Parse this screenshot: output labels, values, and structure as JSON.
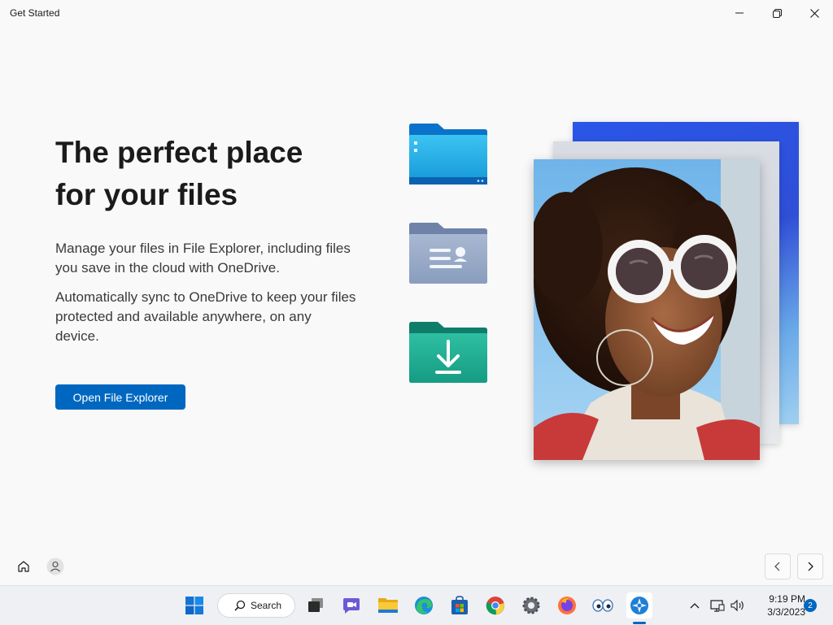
{
  "window": {
    "title": "Get Started",
    "minimize_icon": "minimize-icon",
    "maximize_icon": "restore-icon",
    "close_icon": "close-icon"
  },
  "content": {
    "headline_line1": "The perfect place",
    "headline_line2": "for your files",
    "paragraph1": "Manage your files in File Explorer, including files you save in the cloud with OneDrive.",
    "paragraph2": "Automatically sync to OneDrive to keep your files protected and available anywhere, on any device.",
    "primary_button": "Open File Explorer"
  },
  "illustration": {
    "folders": [
      "blue-folder-icon",
      "documents-folder-icon",
      "downloads-folder-icon"
    ]
  },
  "footer": {
    "home_icon": "home-icon",
    "account_icon": "person-icon",
    "back_icon": "chevron-left-icon",
    "next_icon": "chevron-right-icon"
  },
  "taskbar": {
    "search_label": "Search",
    "apps": [
      "start-icon",
      "search-icon",
      "task-view-icon",
      "chat-icon",
      "file-explorer-icon",
      "edge-icon",
      "store-icon",
      "chrome-icon",
      "settings-icon",
      "firefox-icon",
      "eyes-app-icon",
      "get-started-icon"
    ],
    "time": "9:19 PM",
    "date": "3/3/2023",
    "notification_count": "2"
  },
  "colors": {
    "accent": "#0067c0",
    "background": "#f9f9f9"
  }
}
